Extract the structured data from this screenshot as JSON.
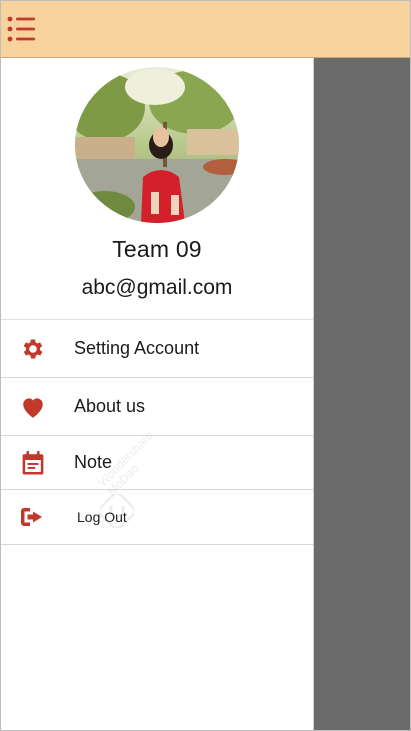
{
  "profile": {
    "name": "Team 09",
    "email": "abc@gmail.com"
  },
  "menu": [
    {
      "label": "Setting Account",
      "icon": "gear-icon"
    },
    {
      "label": "About us",
      "icon": "heart-icon"
    },
    {
      "label": "Note",
      "icon": "calendar-icon"
    },
    {
      "label": "Log Out",
      "icon": "logout-icon"
    }
  ],
  "watermark": {
    "line1": "Wondershare",
    "line2": "MoDao"
  },
  "colors": {
    "header_bg": "#f8d29c",
    "accent": "#c0392b",
    "overlay": "#6b6b6b"
  }
}
